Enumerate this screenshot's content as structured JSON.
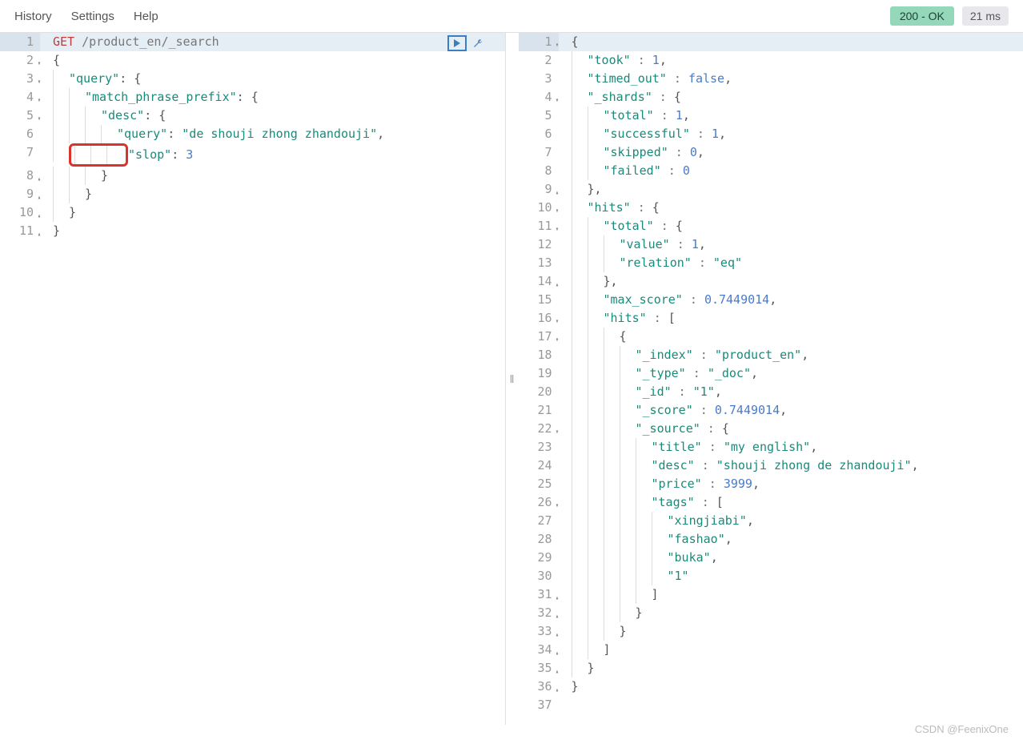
{
  "menu": {
    "history": "History",
    "settings": "Settings",
    "help": "Help"
  },
  "status": {
    "code": "200 - OK",
    "timing": "21 ms"
  },
  "request": {
    "lines": [
      {
        "n": 1,
        "fold": "",
        "active": true,
        "html": [
          [
            "method",
            "GET"
          ],
          [
            "plain",
            " /product_en/_search"
          ]
        ]
      },
      {
        "n": 2,
        "fold": "▾",
        "html": [
          [
            "punct",
            "{"
          ]
        ]
      },
      {
        "n": 3,
        "fold": "▾",
        "html": [
          [
            "plain",
            "  "
          ],
          [
            "key",
            "\"query\""
          ],
          [
            "punct",
            ": {"
          ]
        ]
      },
      {
        "n": 4,
        "fold": "▾",
        "html": [
          [
            "plain",
            "    "
          ],
          [
            "key",
            "\"match_phrase_prefix\""
          ],
          [
            "punct",
            ": {"
          ]
        ]
      },
      {
        "n": 5,
        "fold": "▾",
        "html": [
          [
            "plain",
            "      "
          ],
          [
            "key",
            "\"desc\""
          ],
          [
            "punct",
            ": {"
          ]
        ]
      },
      {
        "n": 6,
        "fold": "",
        "html": [
          [
            "plain",
            "        "
          ],
          [
            "key",
            "\"query\""
          ],
          [
            "punct",
            ": "
          ],
          [
            "str",
            "\"de shouji zhong zhandouji\""
          ],
          [
            "punct",
            ","
          ]
        ]
      },
      {
        "n": 7,
        "fold": "",
        "hl": true,
        "html": [
          [
            "plain",
            "        "
          ],
          [
            "key",
            "\"slop\""
          ],
          [
            "punct",
            ": "
          ],
          [
            "num",
            "3"
          ]
        ]
      },
      {
        "n": 8,
        "fold": "▴",
        "html": [
          [
            "plain",
            "      "
          ],
          [
            "punct",
            "}"
          ]
        ]
      },
      {
        "n": 9,
        "fold": "▴",
        "html": [
          [
            "plain",
            "    "
          ],
          [
            "punct",
            "}"
          ]
        ]
      },
      {
        "n": 10,
        "fold": "▴",
        "html": [
          [
            "plain",
            "  "
          ],
          [
            "punct",
            "}"
          ]
        ]
      },
      {
        "n": 11,
        "fold": "▴",
        "html": [
          [
            "punct",
            "}"
          ]
        ]
      }
    ]
  },
  "response": {
    "lines": [
      {
        "n": 1,
        "fold": "▾",
        "active": true,
        "html": [
          [
            "punct",
            "{"
          ]
        ]
      },
      {
        "n": 2,
        "fold": "",
        "html": [
          [
            "plain",
            "  "
          ],
          [
            "key",
            "\"took\""
          ],
          [
            "plain",
            " : "
          ],
          [
            "num",
            "1"
          ],
          [
            "punct",
            ","
          ]
        ]
      },
      {
        "n": 3,
        "fold": "",
        "html": [
          [
            "plain",
            "  "
          ],
          [
            "key",
            "\"timed_out\""
          ],
          [
            "plain",
            " : "
          ],
          [
            "bool",
            "false"
          ],
          [
            "punct",
            ","
          ]
        ]
      },
      {
        "n": 4,
        "fold": "▾",
        "html": [
          [
            "plain",
            "  "
          ],
          [
            "key",
            "\"_shards\""
          ],
          [
            "plain",
            " : "
          ],
          [
            "punct",
            "{"
          ]
        ]
      },
      {
        "n": 5,
        "fold": "",
        "html": [
          [
            "plain",
            "    "
          ],
          [
            "key",
            "\"total\""
          ],
          [
            "plain",
            " : "
          ],
          [
            "num",
            "1"
          ],
          [
            "punct",
            ","
          ]
        ]
      },
      {
        "n": 6,
        "fold": "",
        "html": [
          [
            "plain",
            "    "
          ],
          [
            "key",
            "\"successful\""
          ],
          [
            "plain",
            " : "
          ],
          [
            "num",
            "1"
          ],
          [
            "punct",
            ","
          ]
        ]
      },
      {
        "n": 7,
        "fold": "",
        "html": [
          [
            "plain",
            "    "
          ],
          [
            "key",
            "\"skipped\""
          ],
          [
            "plain",
            " : "
          ],
          [
            "num",
            "0"
          ],
          [
            "punct",
            ","
          ]
        ]
      },
      {
        "n": 8,
        "fold": "",
        "html": [
          [
            "plain",
            "    "
          ],
          [
            "key",
            "\"failed\""
          ],
          [
            "plain",
            " : "
          ],
          [
            "num",
            "0"
          ]
        ]
      },
      {
        "n": 9,
        "fold": "▴",
        "html": [
          [
            "plain",
            "  "
          ],
          [
            "punct",
            "},"
          ]
        ]
      },
      {
        "n": 10,
        "fold": "▾",
        "html": [
          [
            "plain",
            "  "
          ],
          [
            "key",
            "\"hits\""
          ],
          [
            "plain",
            " : "
          ],
          [
            "punct",
            "{"
          ]
        ]
      },
      {
        "n": 11,
        "fold": "▾",
        "html": [
          [
            "plain",
            "    "
          ],
          [
            "key",
            "\"total\""
          ],
          [
            "plain",
            " : "
          ],
          [
            "punct",
            "{"
          ]
        ]
      },
      {
        "n": 12,
        "fold": "",
        "html": [
          [
            "plain",
            "      "
          ],
          [
            "key",
            "\"value\""
          ],
          [
            "plain",
            " : "
          ],
          [
            "num",
            "1"
          ],
          [
            "punct",
            ","
          ]
        ]
      },
      {
        "n": 13,
        "fold": "",
        "html": [
          [
            "plain",
            "      "
          ],
          [
            "key",
            "\"relation\""
          ],
          [
            "plain",
            " : "
          ],
          [
            "str",
            "\"eq\""
          ]
        ]
      },
      {
        "n": 14,
        "fold": "▴",
        "html": [
          [
            "plain",
            "    "
          ],
          [
            "punct",
            "},"
          ]
        ]
      },
      {
        "n": 15,
        "fold": "",
        "html": [
          [
            "plain",
            "    "
          ],
          [
            "key",
            "\"max_score\""
          ],
          [
            "plain",
            " : "
          ],
          [
            "num",
            "0.7449014"
          ],
          [
            "punct",
            ","
          ]
        ]
      },
      {
        "n": 16,
        "fold": "▾",
        "html": [
          [
            "plain",
            "    "
          ],
          [
            "key",
            "\"hits\""
          ],
          [
            "plain",
            " : "
          ],
          [
            "punct",
            "["
          ]
        ]
      },
      {
        "n": 17,
        "fold": "▾",
        "html": [
          [
            "plain",
            "      "
          ],
          [
            "punct",
            "{"
          ]
        ]
      },
      {
        "n": 18,
        "fold": "",
        "html": [
          [
            "plain",
            "        "
          ],
          [
            "key",
            "\"_index\""
          ],
          [
            "plain",
            " : "
          ],
          [
            "str",
            "\"product_en\""
          ],
          [
            "punct",
            ","
          ]
        ]
      },
      {
        "n": 19,
        "fold": "",
        "html": [
          [
            "plain",
            "        "
          ],
          [
            "key",
            "\"_type\""
          ],
          [
            "plain",
            " : "
          ],
          [
            "str",
            "\"_doc\""
          ],
          [
            "punct",
            ","
          ]
        ]
      },
      {
        "n": 20,
        "fold": "",
        "html": [
          [
            "plain",
            "        "
          ],
          [
            "key",
            "\"_id\""
          ],
          [
            "plain",
            " : "
          ],
          [
            "str",
            "\"1\""
          ],
          [
            "punct",
            ","
          ]
        ]
      },
      {
        "n": 21,
        "fold": "",
        "html": [
          [
            "plain",
            "        "
          ],
          [
            "key",
            "\"_score\""
          ],
          [
            "plain",
            " : "
          ],
          [
            "num",
            "0.7449014"
          ],
          [
            "punct",
            ","
          ]
        ]
      },
      {
        "n": 22,
        "fold": "▾",
        "html": [
          [
            "plain",
            "        "
          ],
          [
            "key",
            "\"_source\""
          ],
          [
            "plain",
            " : "
          ],
          [
            "punct",
            "{"
          ]
        ]
      },
      {
        "n": 23,
        "fold": "",
        "html": [
          [
            "plain",
            "          "
          ],
          [
            "key",
            "\"title\""
          ],
          [
            "plain",
            " : "
          ],
          [
            "str",
            "\"my english\""
          ],
          [
            "punct",
            ","
          ]
        ]
      },
      {
        "n": 24,
        "fold": "",
        "html": [
          [
            "plain",
            "          "
          ],
          [
            "key",
            "\"desc\""
          ],
          [
            "plain",
            " : "
          ],
          [
            "str",
            "\"shouji zhong de zhandouji\""
          ],
          [
            "punct",
            ","
          ]
        ]
      },
      {
        "n": 25,
        "fold": "",
        "html": [
          [
            "plain",
            "          "
          ],
          [
            "key",
            "\"price\""
          ],
          [
            "plain",
            " : "
          ],
          [
            "num",
            "3999"
          ],
          [
            "punct",
            ","
          ]
        ]
      },
      {
        "n": 26,
        "fold": "▾",
        "html": [
          [
            "plain",
            "          "
          ],
          [
            "key",
            "\"tags\""
          ],
          [
            "plain",
            " : "
          ],
          [
            "punct",
            "["
          ]
        ]
      },
      {
        "n": 27,
        "fold": "",
        "html": [
          [
            "plain",
            "            "
          ],
          [
            "str",
            "\"xingjiabi\""
          ],
          [
            "punct",
            ","
          ]
        ]
      },
      {
        "n": 28,
        "fold": "",
        "html": [
          [
            "plain",
            "            "
          ],
          [
            "str",
            "\"fashao\""
          ],
          [
            "punct",
            ","
          ]
        ]
      },
      {
        "n": 29,
        "fold": "",
        "html": [
          [
            "plain",
            "            "
          ],
          [
            "str",
            "\"buka\""
          ],
          [
            "punct",
            ","
          ]
        ]
      },
      {
        "n": 30,
        "fold": "",
        "html": [
          [
            "plain",
            "            "
          ],
          [
            "str",
            "\"1\""
          ]
        ]
      },
      {
        "n": 31,
        "fold": "▴",
        "html": [
          [
            "plain",
            "          "
          ],
          [
            "punct",
            "]"
          ]
        ]
      },
      {
        "n": 32,
        "fold": "▴",
        "html": [
          [
            "plain",
            "        "
          ],
          [
            "punct",
            "}"
          ]
        ]
      },
      {
        "n": 33,
        "fold": "▴",
        "html": [
          [
            "plain",
            "      "
          ],
          [
            "punct",
            "}"
          ]
        ]
      },
      {
        "n": 34,
        "fold": "▴",
        "html": [
          [
            "plain",
            "    "
          ],
          [
            "punct",
            "]"
          ]
        ]
      },
      {
        "n": 35,
        "fold": "▴",
        "html": [
          [
            "plain",
            "  "
          ],
          [
            "punct",
            "}"
          ]
        ]
      },
      {
        "n": 36,
        "fold": "▴",
        "html": [
          [
            "punct",
            "}"
          ]
        ]
      },
      {
        "n": 37,
        "fold": "",
        "html": []
      }
    ]
  },
  "footer": "CSDN @FeenixOne"
}
